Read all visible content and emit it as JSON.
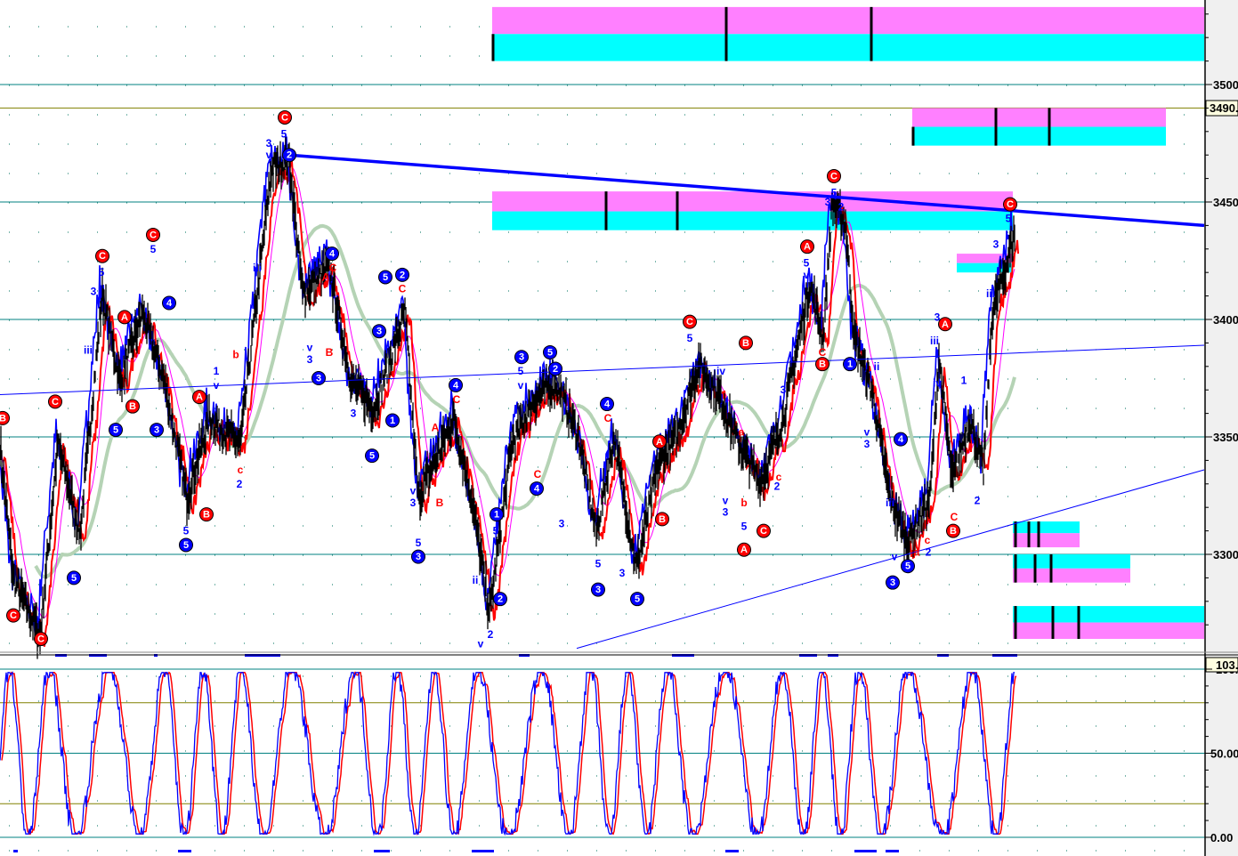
{
  "colors": {
    "teal": "#008080",
    "olive": "#808000",
    "blue": "#0000ff",
    "red": "#ff0000",
    "black": "#000000",
    "magenta": "#ff80ff",
    "cyan": "#00ffff",
    "ma_green": "#b5d3b5",
    "ma_magenta": "#ff00ff",
    "axis_bg": "#f0f0f0"
  },
  "chart_data": [
    {
      "type": "line",
      "title": "Price with Elliott wave labels",
      "xlabel": "",
      "ylabel": "",
      "xlim": [
        0,
        1353
      ],
      "ylim": [
        3262,
        3536
      ],
      "grid": true,
      "y_ticks": [
        "3500",
        "3450",
        "3400",
        "3350",
        "3300"
      ],
      "y_tick_values": [
        3500,
        3450,
        3400,
        3350,
        3300
      ],
      "current_price_label": "3490.",
      "current_price": 3490,
      "price_keypoints": [
        [
          0,
          3347
        ],
        [
          15,
          3290
        ],
        [
          45,
          3265
        ],
        [
          65,
          3347
        ],
        [
          90,
          3309
        ],
        [
          115,
          3411
        ],
        [
          135,
          3373
        ],
        [
          160,
          3403
        ],
        [
          185,
          3373
        ],
        [
          210,
          3324
        ],
        [
          235,
          3358
        ],
        [
          270,
          3347
        ],
        [
          305,
          3464
        ],
        [
          325,
          3468
        ],
        [
          340,
          3411
        ],
        [
          370,
          3422
        ],
        [
          395,
          3373
        ],
        [
          420,
          3362
        ],
        [
          455,
          3403
        ],
        [
          470,
          3324
        ],
        [
          510,
          3358
        ],
        [
          530,
          3324
        ],
        [
          550,
          3275
        ],
        [
          575,
          3347
        ],
        [
          600,
          3366
        ],
        [
          625,
          3373
        ],
        [
          650,
          3350
        ],
        [
          670,
          3309
        ],
        [
          690,
          3350
        ],
        [
          715,
          3294
        ],
        [
          740,
          3339
        ],
        [
          760,
          3350
        ],
        [
          785,
          3381
        ],
        [
          810,
          3366
        ],
        [
          830,
          3347
        ],
        [
          855,
          3331
        ],
        [
          880,
          3358
        ],
        [
          910,
          3415
        ],
        [
          925,
          3392
        ],
        [
          935,
          3449
        ],
        [
          950,
          3441
        ],
        [
          960,
          3392
        ],
        [
          980,
          3369
        ],
        [
          1000,
          3324
        ],
        [
          1020,
          3305
        ],
        [
          1045,
          3324
        ],
        [
          1055,
          3384
        ],
        [
          1070,
          3331
        ],
        [
          1090,
          3358
        ],
        [
          1105,
          3335
        ],
        [
          1115,
          3403
        ],
        [
          1130,
          3422
        ],
        [
          1140,
          3437
        ]
      ],
      "series": [
        {
          "name": "price-black"
        },
        {
          "name": "price-blue"
        },
        {
          "name": "price-red"
        },
        {
          "name": "ma-magenta"
        },
        {
          "name": "ma-green"
        }
      ],
      "horizontal_lines": [
        {
          "value": 3500,
          "color": "teal"
        },
        {
          "value": 3490,
          "color": "olive"
        },
        {
          "value": 3450,
          "color": "teal"
        },
        {
          "value": 3400,
          "color": "teal"
        },
        {
          "value": 3350,
          "color": "teal"
        },
        {
          "value": 3300,
          "color": "teal"
        }
      ],
      "trendlines": [
        {
          "name": "upper-resistance",
          "from": [
            325,
            3470
          ],
          "to": [
            1353,
            3440
          ],
          "width": "thick"
        },
        {
          "name": "mid-channel",
          "from": [
            0,
            3368
          ],
          "to": [
            1353,
            3389
          ],
          "width": "thin"
        },
        {
          "name": "lower-support",
          "from": [
            648,
            3260
          ],
          "to": [
            1353,
            3336
          ],
          "width": "thin"
        }
      ],
      "zones": [
        {
          "x": [
            553,
            1353
          ],
          "top": [
            3533,
            3521.5
          ],
          "bottom": [
            3521.5,
            3510
          ],
          "top_color": "magenta",
          "bottom_color": "cyan",
          "marks": [
            553,
            815,
            978
          ]
        },
        {
          "x": [
            1025,
            1310
          ],
          "top": [
            3490,
            3482
          ],
          "bottom": [
            3482,
            3474
          ],
          "top_color": "magenta",
          "bottom_color": "cyan",
          "marks": [
            1025,
            1118,
            1178
          ]
        },
        {
          "x": [
            553,
            1138
          ],
          "top": [
            3454.5,
            3446
          ],
          "bottom": [
            3446,
            3438
          ],
          "top_color": "magenta",
          "bottom_color": "cyan",
          "marks": [
            680,
            760
          ]
        },
        {
          "x": [
            1075,
            1138
          ],
          "top": [
            3428,
            3424
          ],
          "bottom": [
            3424,
            3420
          ],
          "top_color": "magenta",
          "bottom_color": "cyan",
          "marks": []
        },
        {
          "x": [
            1138,
            1213
          ],
          "top": [
            3314,
            3309
          ],
          "bottom": [
            3309,
            3303
          ],
          "top_color": "cyan",
          "bottom_color": "magenta",
          "marks": [
            1140,
            1155,
            1166
          ]
        },
        {
          "x": [
            1138,
            1270
          ],
          "top": [
            3300,
            3294
          ],
          "bottom": [
            3294,
            3288
          ],
          "top_color": "cyan",
          "bottom_color": "magenta",
          "marks": [
            1140,
            1162,
            1180
          ]
        },
        {
          "x": [
            1138,
            1353
          ],
          "top": [
            3278,
            3271
          ],
          "bottom": [
            3271,
            3264
          ],
          "top_color": "cyan",
          "bottom_color": "magenta",
          "marks": [
            1140,
            1182,
            1211
          ]
        }
      ],
      "wave_labels_circled": [
        [
          320,
          3486,
          "C",
          "red"
        ],
        [
          325,
          3470,
          "2",
          "blue"
        ],
        [
          115,
          3427,
          "C",
          "red"
        ],
        [
          172,
          3436,
          "C",
          "red"
        ],
        [
          62,
          3365,
          "C",
          "red"
        ],
        [
          937,
          3461,
          "C",
          "red"
        ],
        [
          775,
          3399,
          "C",
          "red"
        ],
        [
          1135,
          3449,
          "C",
          "red"
        ],
        [
          907,
          3431,
          "A",
          "red"
        ],
        [
          1062,
          3398,
          "A",
          "red"
        ],
        [
          140,
          3401,
          "A",
          "red"
        ],
        [
          224,
          3367,
          "A",
          "red"
        ],
        [
          741,
          3348,
          "A",
          "red"
        ],
        [
          836,
          3302,
          "A",
          "red"
        ],
        [
          232,
          3317,
          "B",
          "red"
        ],
        [
          149,
          3363,
          "B",
          "red"
        ],
        [
          744,
          3315,
          "B",
          "red"
        ],
        [
          838,
          3390,
          "B",
          "red"
        ],
        [
          924,
          3381,
          "B",
          "red"
        ],
        [
          1071,
          3310,
          "B",
          "red"
        ],
        [
          3,
          3358,
          "B",
          "red"
        ],
        [
          858,
          3310,
          "C",
          "red"
        ],
        [
          15,
          3274,
          "C",
          "red"
        ],
        [
          46,
          3264,
          "C",
          "red"
        ],
        [
          373,
          3428,
          "4",
          "blue"
        ],
        [
          433,
          3418,
          "5",
          "blue"
        ],
        [
          452,
          3419,
          "2",
          "blue"
        ],
        [
          358,
          3375,
          "3",
          "blue"
        ],
        [
          209,
          3304,
          "5",
          "blue"
        ],
        [
          176,
          3353,
          "3",
          "blue"
        ],
        [
          130,
          3353,
          "5",
          "blue"
        ],
        [
          83,
          3290,
          "5",
          "blue"
        ],
        [
          470,
          3299,
          "3",
          "blue"
        ],
        [
          418,
          3342,
          "5",
          "blue"
        ],
        [
          512,
          3372,
          "4",
          "blue"
        ],
        [
          558,
          3317,
          "1",
          "blue"
        ],
        [
          562,
          3281,
          "2",
          "blue"
        ],
        [
          586,
          3384,
          "3",
          "blue"
        ],
        [
          618,
          3386,
          "5",
          "blue"
        ],
        [
          624,
          3379,
          "2",
          "blue"
        ],
        [
          603,
          3328,
          "4",
          "blue"
        ],
        [
          672,
          3285,
          "3",
          "blue"
        ],
        [
          716,
          3281,
          "5",
          "blue"
        ],
        [
          682,
          3364,
          "4",
          "blue"
        ],
        [
          1003,
          3288,
          "3",
          "blue"
        ],
        [
          1020,
          3295,
          "5",
          "blue"
        ],
        [
          1012,
          3349,
          "4",
          "blue"
        ],
        [
          955,
          3381,
          "1",
          "blue"
        ],
        [
          441,
          3357,
          "1",
          "blue"
        ],
        [
          426,
          3395,
          "3",
          "blue"
        ],
        [
          190,
          3407,
          "4",
          "blue"
        ]
      ],
      "wave_labels_plain": [
        [
          319,
          3479,
          "5",
          "blue"
        ],
        [
          302,
          3475,
          "3",
          "blue"
        ],
        [
          302,
          3470,
          "v",
          "blue"
        ],
        [
          289,
          3422,
          "iii",
          "blue"
        ],
        [
          172,
          3430,
          "5",
          "blue"
        ],
        [
          114,
          3420,
          "5",
          "blue"
        ],
        [
          105,
          3412,
          "3",
          "blue"
        ],
        [
          99,
          3387,
          "iii",
          "blue"
        ],
        [
          243,
          3378,
          "1",
          "blue"
        ],
        [
          243,
          3372,
          "v",
          "blue"
        ],
        [
          209,
          3310,
          "5",
          "blue"
        ],
        [
          265,
          3385,
          "b",
          "red"
        ],
        [
          270,
          3336,
          "c",
          "red"
        ],
        [
          269,
          3330,
          "2",
          "blue"
        ],
        [
          452,
          3413,
          "C",
          "red"
        ],
        [
          374,
          3422,
          "C",
          "red"
        ],
        [
          366,
          3418,
          "A",
          "red"
        ],
        [
          348,
          3388,
          "v",
          "blue"
        ],
        [
          348,
          3383,
          "3",
          "blue"
        ],
        [
          370,
          3386,
          "B",
          "red"
        ],
        [
          397,
          3360,
          "3",
          "blue"
        ],
        [
          489,
          3354,
          "A",
          "red"
        ],
        [
          494,
          3322,
          "B",
          "red"
        ],
        [
          513,
          3366,
          "C",
          "red"
        ],
        [
          464,
          3327,
          "v",
          "blue"
        ],
        [
          464,
          3322,
          "3",
          "blue"
        ],
        [
          470,
          3305,
          "5",
          "blue"
        ],
        [
          534,
          3289,
          "ii",
          "blue"
        ],
        [
          540,
          3262,
          "v",
          "blue"
        ],
        [
          551,
          3266,
          "2",
          "blue"
        ],
        [
          557,
          3310,
          "5",
          "blue"
        ],
        [
          585,
          3378,
          "5",
          "blue"
        ],
        [
          585,
          3372,
          "v",
          "blue"
        ],
        [
          604,
          3334,
          "C",
          "red"
        ],
        [
          631,
          3313,
          "3",
          "blue"
        ],
        [
          683,
          3358,
          "C",
          "red"
        ],
        [
          672,
          3296,
          "5",
          "blue"
        ],
        [
          699,
          3292,
          "3",
          "blue"
        ],
        [
          775,
          3392,
          "5",
          "blue"
        ],
        [
          810,
          3378,
          "iv",
          "blue"
        ],
        [
          815,
          3323,
          "v",
          "blue"
        ],
        [
          815,
          3318,
          "3",
          "blue"
        ],
        [
          836,
          3312,
          "5",
          "blue"
        ],
        [
          836,
          3322,
          "b",
          "red"
        ],
        [
          833,
          3352,
          "a",
          "red"
        ],
        [
          875,
          3333,
          "c",
          "red"
        ],
        [
          873,
          3329,
          "2",
          "blue"
        ],
        [
          880,
          3370,
          "3",
          "blue"
        ],
        [
          906,
          3424,
          "5",
          "blue"
        ],
        [
          906,
          3419,
          "v",
          "blue"
        ],
        [
          924,
          3386,
          "C",
          "red"
        ],
        [
          937,
          3454,
          "5",
          "blue"
        ],
        [
          930,
          3450,
          "3",
          "blue"
        ],
        [
          945,
          3448,
          "2",
          "blue"
        ],
        [
          985,
          3380,
          "ii",
          "blue"
        ],
        [
          974,
          3352,
          "v",
          "blue"
        ],
        [
          974,
          3347,
          "3",
          "blue"
        ],
        [
          1000,
          3322,
          "iii",
          "blue"
        ],
        [
          1005,
          3299,
          "v",
          "blue"
        ],
        [
          1030,
          3301,
          "a",
          "red"
        ],
        [
          1043,
          3301,
          "2",
          "blue"
        ],
        [
          1042,
          3306,
          "c",
          "red"
        ],
        [
          1053,
          3401,
          "3",
          "blue"
        ],
        [
          1050,
          3391,
          "iii",
          "blue"
        ],
        [
          1053,
          3373,
          "iv",
          "blue"
        ],
        [
          1083,
          3374,
          "1",
          "blue"
        ],
        [
          1072,
          3316,
          "C",
          "red"
        ],
        [
          1098,
          3323,
          "2",
          "blue"
        ],
        [
          1119,
          3432,
          "3",
          "blue"
        ],
        [
          1113,
          3411,
          "iii",
          "blue"
        ],
        [
          1133,
          3443,
          "5",
          "blue"
        ]
      ]
    },
    {
      "type": "line",
      "title": "Stochastic oscillator",
      "ylim": [
        0,
        100
      ],
      "y_ticks": [
        "50.00",
        "0.00"
      ],
      "y_tick_values": [
        50,
        0
      ],
      "current_value_label": "103.",
      "top_tick_label": "100.0",
      "horizontal_lines": [
        {
          "value": 100,
          "color": "teal"
        },
        {
          "value": 80,
          "color": "olive"
        },
        {
          "value": 50,
          "color": "teal"
        },
        {
          "value": 20,
          "color": "olive"
        },
        {
          "value": 0,
          "color": "teal"
        }
      ],
      "series": [
        {
          "name": "%K",
          "color": "blue"
        },
        {
          "name": "%D",
          "color": "red"
        }
      ],
      "last_x": 1140
    }
  ]
}
